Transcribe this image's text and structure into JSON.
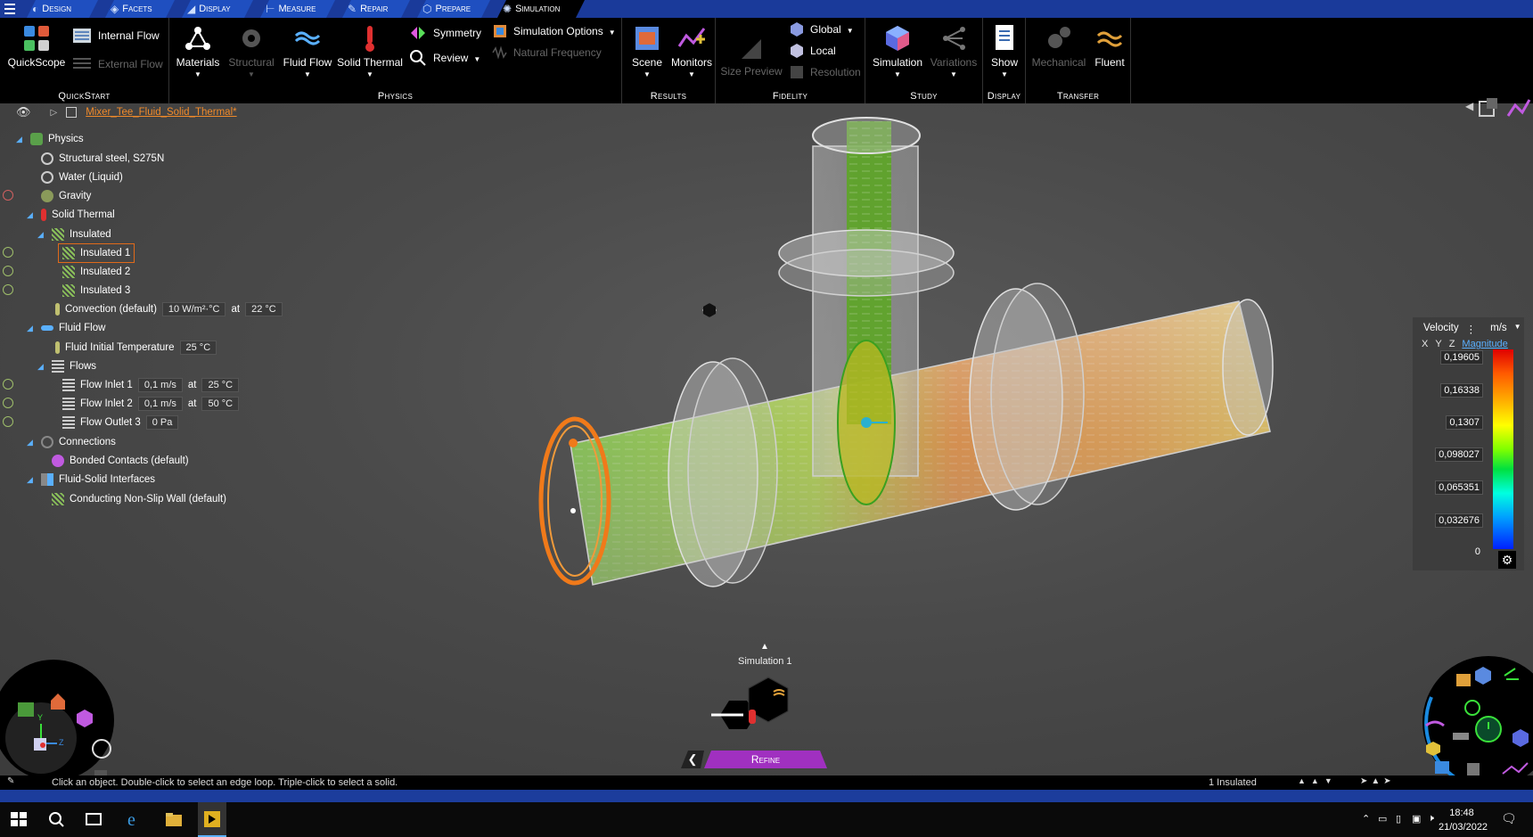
{
  "tabs": [
    {
      "label": "Design",
      "icon": "design-icon"
    },
    {
      "label": "Facets",
      "icon": "facets-icon"
    },
    {
      "label": "Display",
      "icon": "display-icon"
    },
    {
      "label": "Measure",
      "icon": "measure-icon"
    },
    {
      "label": "Repair",
      "icon": "repair-icon"
    },
    {
      "label": "Prepare",
      "icon": "prepare-icon"
    },
    {
      "label": "Simulation",
      "icon": "simulation-icon",
      "active": true
    }
  ],
  "ribbon": {
    "quickstart": {
      "label": "QuickStart",
      "quickscope": "QuickScope",
      "internal_flow": "Internal Flow",
      "external_flow": "External Flow"
    },
    "physics": {
      "label": "Physics",
      "materials": "Materials",
      "structural": "Structural",
      "fluid_flow": "Fluid Flow",
      "solid_thermal": "Solid Thermal",
      "symmetry": "Symmetry",
      "review": "Review",
      "simulation_options": "Simulation Options",
      "natural_frequency": "Natural Frequency"
    },
    "results": {
      "label": "Results",
      "scene": "Scene",
      "monitors": "Monitors"
    },
    "fidelity": {
      "label": "Fidelity",
      "size_preview": "Size Preview",
      "global": "Global",
      "local": "Local",
      "resolution": "Resolution"
    },
    "study": {
      "label": "Study",
      "simulation": "Simulation",
      "variations": "Variations"
    },
    "display": {
      "label": "Display",
      "show": "Show"
    },
    "transfer": {
      "label": "Transfer",
      "mechanical": "Mechanical",
      "fluent": "Fluent"
    }
  },
  "document": {
    "title": "Mixer_Tee_Fluid_Solid_Thermal*"
  },
  "tree": {
    "physics": "Physics",
    "structural_steel": "Structural steel, S275N",
    "water": "Water (Liquid)",
    "gravity": "Gravity",
    "solid_thermal": "Solid Thermal",
    "insulated": "Insulated",
    "insulated1": "Insulated 1",
    "insulated2": "Insulated 2",
    "insulated3": "Insulated 3",
    "convection": "Convection (default)",
    "convection_coeff": "10 W/m²·°C",
    "at": "at",
    "convection_temp": "22 °C",
    "fluid_flow": "Fluid Flow",
    "fluid_init_temp": "Fluid Initial Temperature",
    "fluid_init_temp_val": "25 °C",
    "flows": "Flows",
    "inlet1": "Flow Inlet 1",
    "inlet1_vel": "0,1 m/s",
    "inlet1_temp": "25 °C",
    "inlet2": "Flow Inlet 2",
    "inlet2_vel": "0,1 m/s",
    "inlet2_temp": "50 °C",
    "outlet3": "Flow Outlet 3",
    "outlet3_p": "0 Pa",
    "connections": "Connections",
    "bonded": "Bonded Contacts (default)",
    "fsi": "Fluid-Solid Interfaces",
    "wall": "Conducting Non-Slip Wall (default)"
  },
  "legend": {
    "quantity": "Velocity",
    "unit": "m/s",
    "components": [
      "X",
      "Y",
      "Z"
    ],
    "component_active": "Magnitude",
    "ticks": [
      "0,19605",
      "0,16338",
      "0,1307",
      "0,098027",
      "0,065351",
      "0,032676",
      "0"
    ]
  },
  "bottom": {
    "simulation_name": "Simulation 1",
    "refine": "Refine"
  },
  "status": {
    "hint": "Click an object. Double-click to select an edge loop. Triple-click to select a solid.",
    "selection": "1 Insulated"
  },
  "taskbar": {
    "time": "18:48",
    "date": "21/03/2022"
  }
}
